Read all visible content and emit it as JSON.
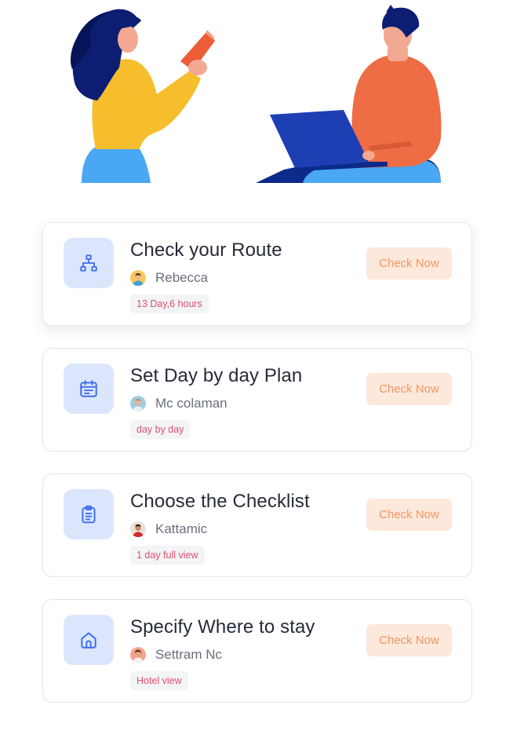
{
  "tasks": [
    {
      "title": "Check your Route",
      "person": "Rebecca",
      "tag": "13 Day,6 hours",
      "button": "Check Now",
      "icon": "sitemap-icon"
    },
    {
      "title": "Set Day by day Plan",
      "person": "Mc colaman",
      "tag": "day by day",
      "button": "Check Now",
      "icon": "calendar-icon"
    },
    {
      "title": "Choose the Checklist",
      "person": "Kattamic",
      "tag": "1 day full view",
      "button": "Check Now",
      "icon": "clipboard-icon"
    },
    {
      "title": "Specify Where to stay",
      "person": "Settram Nc",
      "tag": "Hotel view",
      "button": "Check Now",
      "icon": "home-icon"
    }
  ],
  "colors": {
    "accent_blue": "#3f6cf0",
    "icon_bg": "#dbe6fd",
    "button_bg": "#fde8dc",
    "button_text": "#f0975f",
    "tag_text": "#e0506d"
  }
}
